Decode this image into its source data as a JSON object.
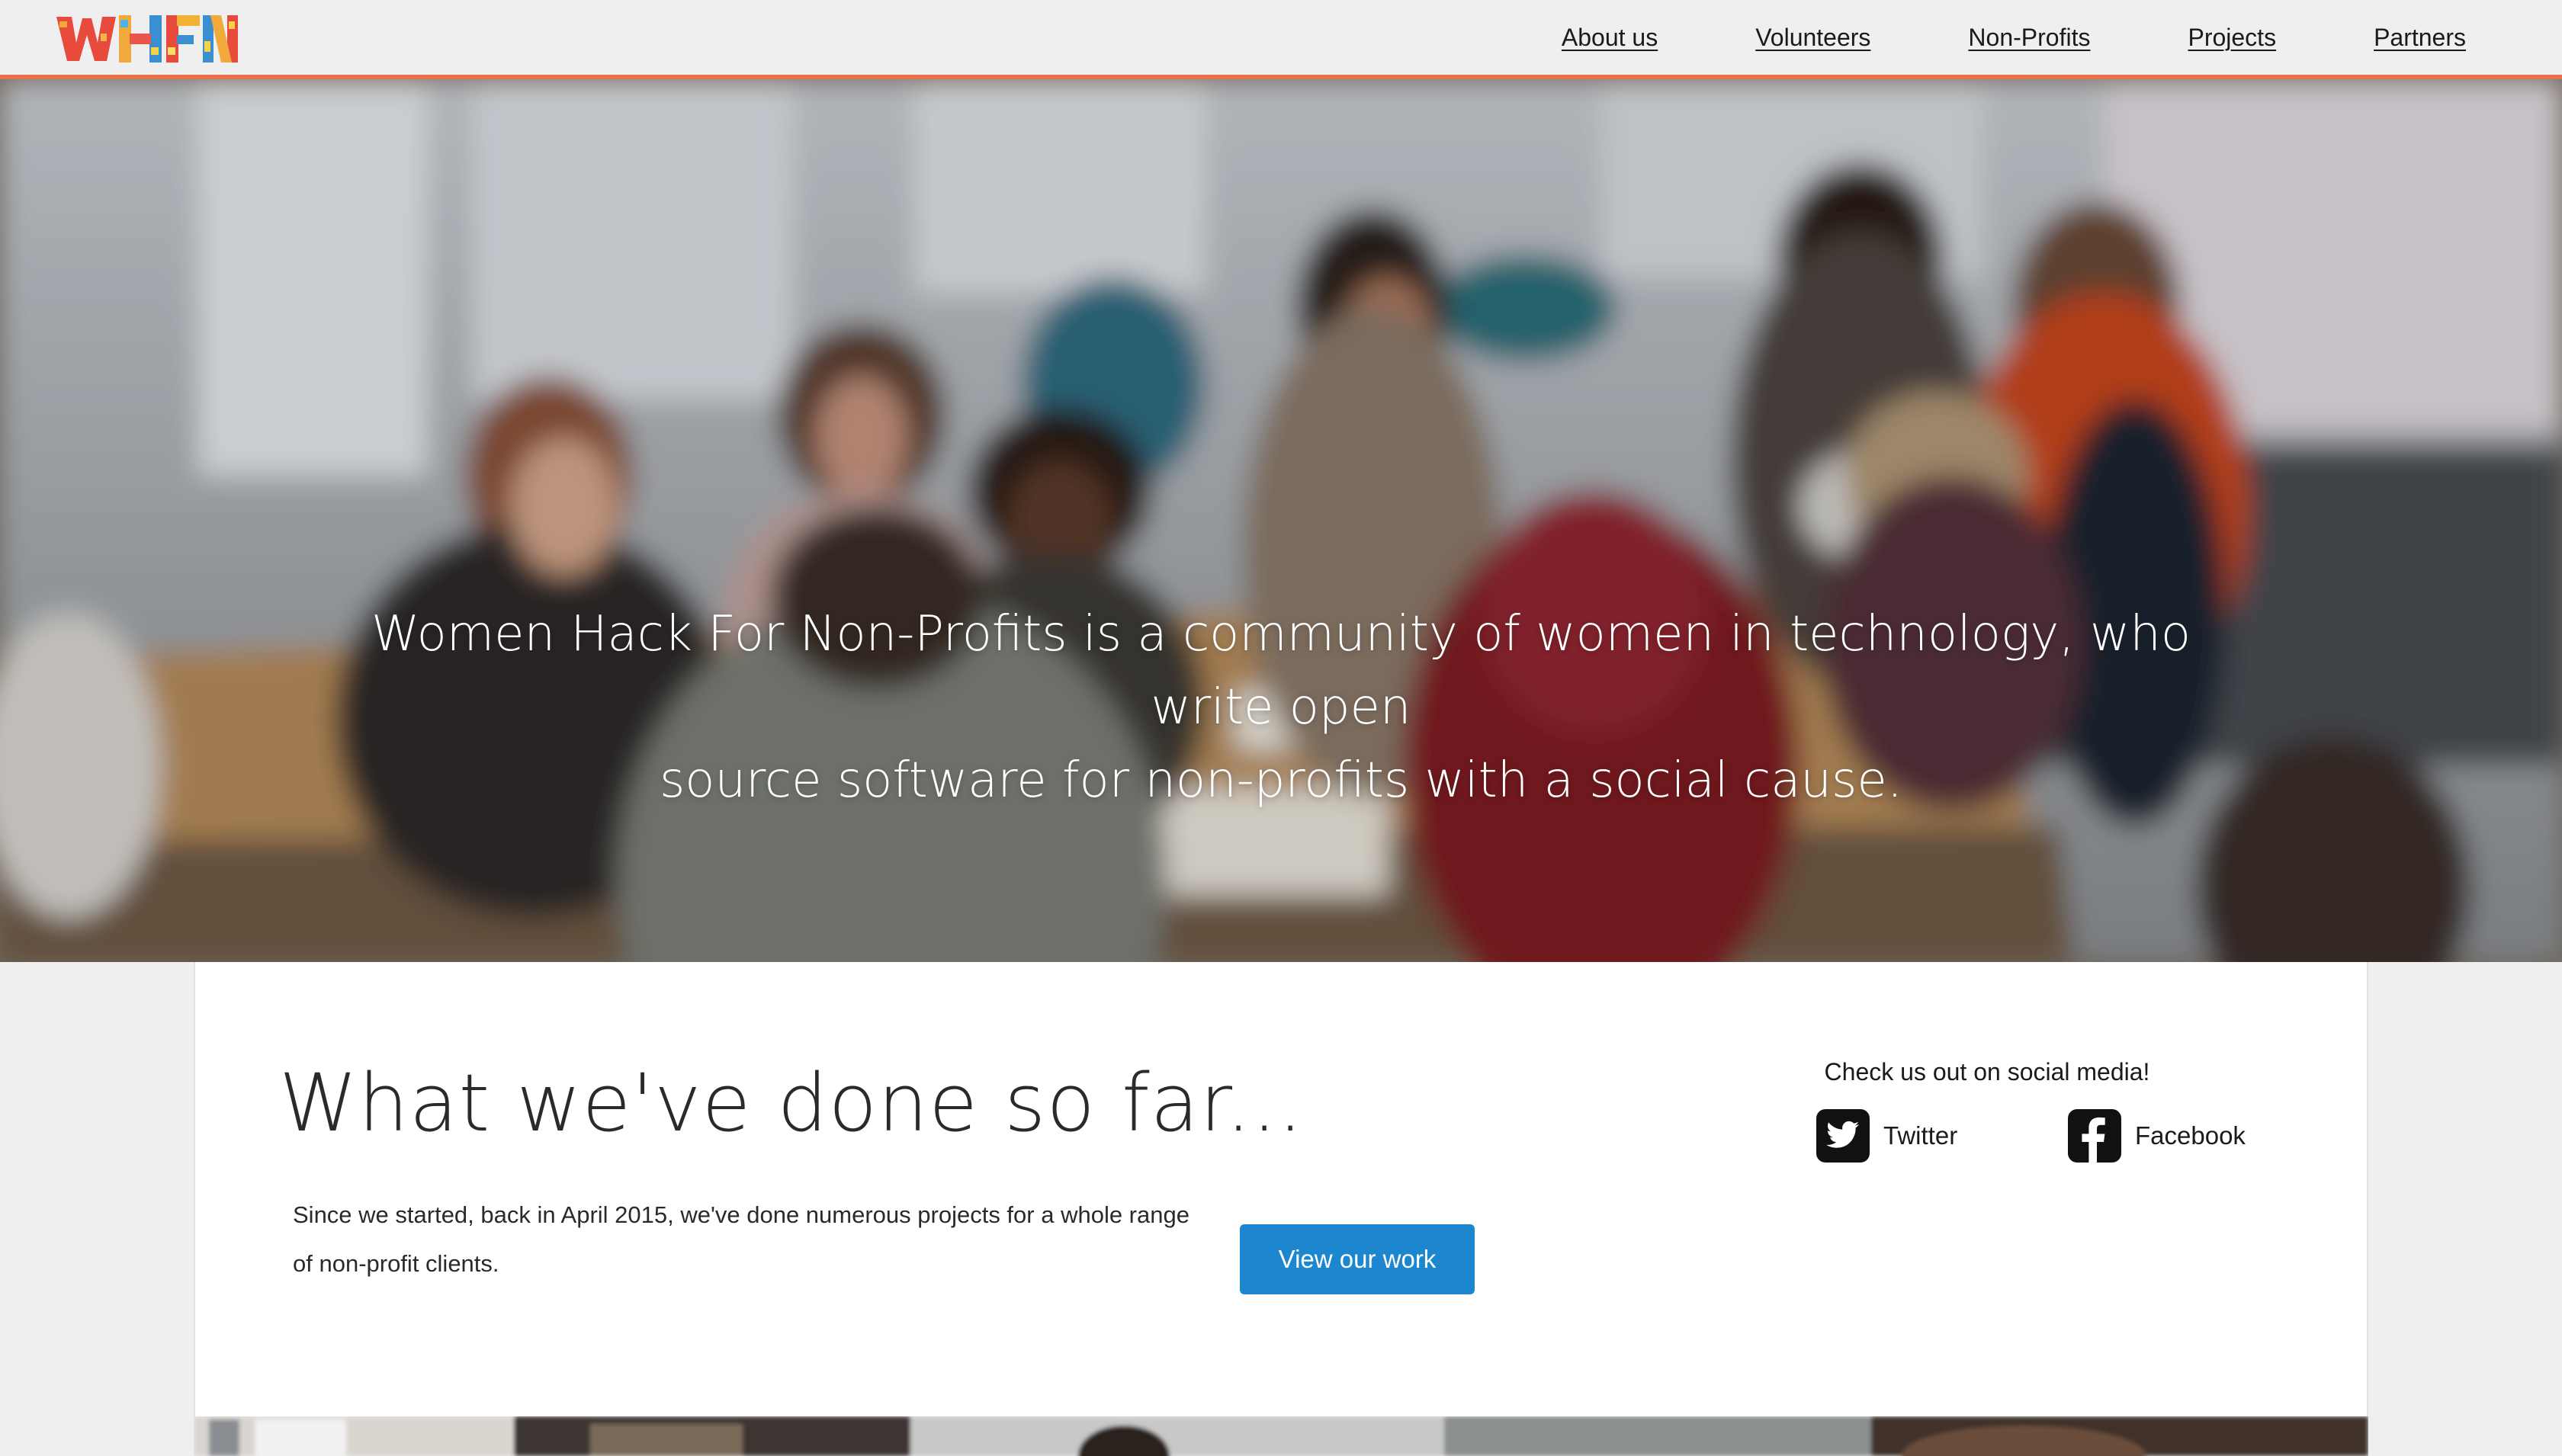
{
  "header": {
    "logo_text": "WHFN",
    "nav": [
      {
        "label": "About us"
      },
      {
        "label": "Volunteers"
      },
      {
        "label": "Non-Profits"
      },
      {
        "label": "Projects"
      },
      {
        "label": "Partners"
      }
    ],
    "accent_color": "#e8734a"
  },
  "hero": {
    "line1": "Women Hack For Non-Profits is a community of women in technology, who write open",
    "line2": "source software for non-profits with a social cause."
  },
  "main": {
    "title": "What we've done so far...",
    "text_line1": "Since we started, back in April 2015, we've done numerous projects for a whole range",
    "text_line2": "of non-profit clients.",
    "button_label": "View our work",
    "button_color": "#1c86cf"
  },
  "social": {
    "title": "Check us out on social media!",
    "twitter_label": "Twitter",
    "facebook_label": "Facebook"
  }
}
